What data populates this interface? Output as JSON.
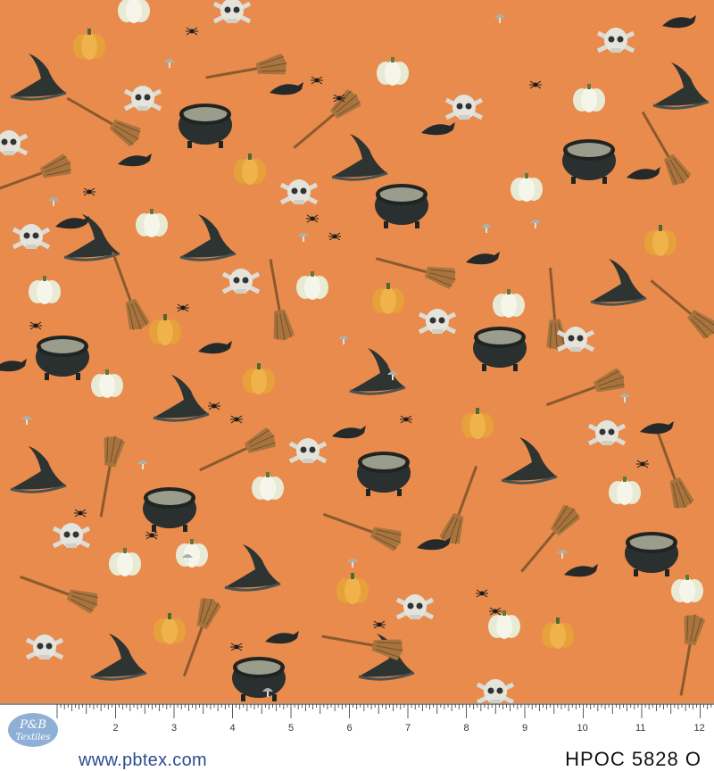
{
  "swatch": {
    "background_color": "#e98b4c",
    "motifs": [
      "witch-hat-icon",
      "cauldron-icon",
      "broom-icon",
      "pumpkin-icon",
      "skull-icon",
      "crow-icon",
      "spider-icon",
      "mushroom-icon"
    ]
  },
  "brand": {
    "logo_line1": "P&B",
    "logo_line2": "Textiles",
    "url": "www.pbtex.com"
  },
  "product_code": "HPOC 5828 O",
  "ruler": {
    "labels": [
      "2",
      "3",
      "4",
      "5",
      "6",
      "7",
      "8",
      "9",
      "10",
      "11",
      "12"
    ]
  }
}
